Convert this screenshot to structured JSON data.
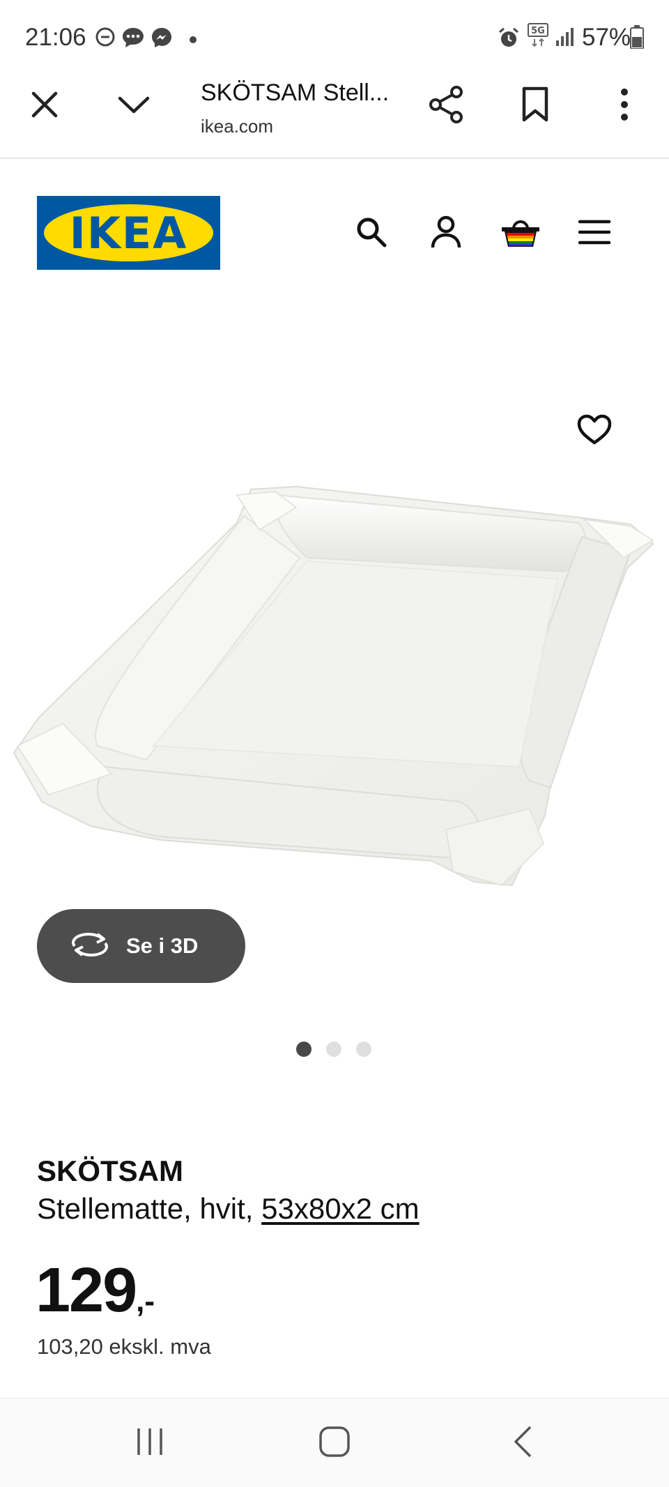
{
  "status_bar": {
    "time": "21:06",
    "network": "5G",
    "battery": "57%",
    "icons": [
      "dnd-icon",
      "chat-bubble-icon",
      "messenger-icon",
      "notification-dot-icon",
      "alarm-icon",
      "network-5g-icon",
      "signal-icon",
      "battery-icon"
    ]
  },
  "browser": {
    "title": "SKÖTSAM Stell...",
    "domain": "ikea.com",
    "icons": [
      "close-icon",
      "chevron-down-icon",
      "share-icon",
      "bookmark-icon",
      "more-vertical-icon"
    ]
  },
  "site_header": {
    "logo_text": "IKEA",
    "logo_colors": {
      "blue": "#0058a3",
      "yellow": "#ffdb00"
    },
    "icons": [
      "search-icon",
      "account-icon",
      "shopping-bag-icon",
      "menu-icon"
    ]
  },
  "product": {
    "view_3d_label": "Se i 3D",
    "carousel": {
      "count": 3,
      "active": 1
    },
    "name": "SKÖTSAM",
    "description": "Stellematte, hvit, ",
    "size_link": "53x80x2 cm",
    "price_int": "129",
    "price_suffix": ",-",
    "price_excl_vat": "103,20 ekskl. mva"
  },
  "nav_bar": {
    "icons": [
      "recent-apps-icon",
      "home-icon",
      "back-icon"
    ]
  }
}
